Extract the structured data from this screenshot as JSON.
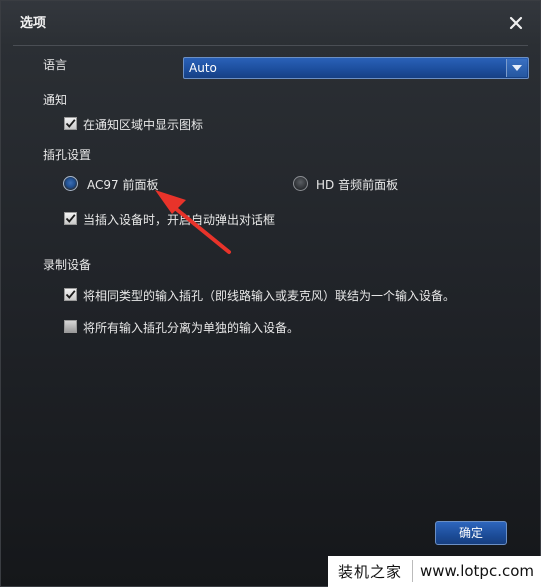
{
  "window": {
    "title": "选项",
    "close_icon": "close-icon"
  },
  "language": {
    "label": "语言",
    "selected": "Auto",
    "dropdown_icon": "chevron-down-icon"
  },
  "notification": {
    "section_label": "通知",
    "show_tray_icon": {
      "label": "在通知区域中显示图标",
      "checked": true
    }
  },
  "jack_settings": {
    "section_label": "插孔设置",
    "options": [
      {
        "label": "AC97 前面板",
        "selected": true
      },
      {
        "label": "HD 音频前面板",
        "selected": false
      }
    ],
    "popup_dialog": {
      "label": "当插入设备时，开启自动弹出对话框",
      "checked": true
    }
  },
  "recording_device": {
    "section_label": "录制设备",
    "options": [
      {
        "label": "将相同类型的输入插孔（即线路输入或麦克风）联结为一个输入设备。",
        "checked": true
      },
      {
        "label": "将所有输入插孔分离为单独的输入设备。",
        "checked": false
      }
    ]
  },
  "footer": {
    "ok_label": "确定"
  },
  "watermark": {
    "cn_text": "装机之家",
    "url_text": "www.lotpc.com"
  },
  "colors": {
    "accent": "#1d4f9e",
    "annotation_arrow": "#e8332a"
  }
}
